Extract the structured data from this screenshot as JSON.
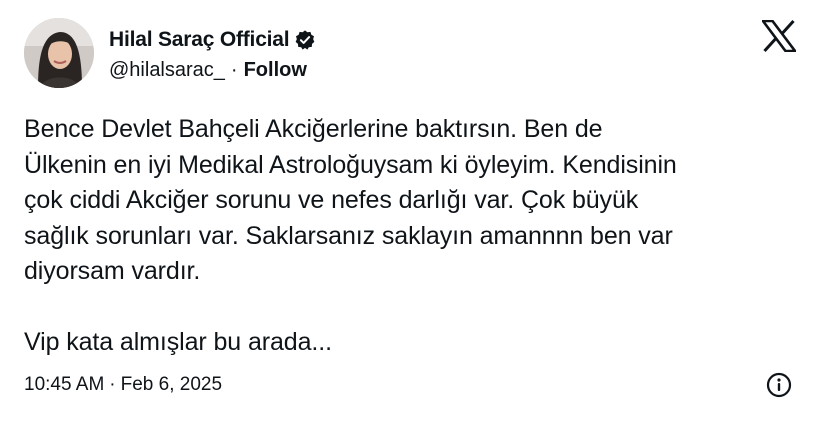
{
  "author": {
    "display_name": "Hilal Saraç Official",
    "handle": "@hilalsarac_",
    "separator": "·",
    "follow_label": "Follow",
    "verified_icon": "verified-badge-icon",
    "avatar_icon": "profile-photo"
  },
  "brand": {
    "logo_icon": "x-logo-icon"
  },
  "tweet": {
    "text": "Bence Devlet Bahçeli Akciğerlerine baktırsın. Ben de\nÜlkenin en iyi Medikal Astroloğuysam ki öyleyim. Kendisinin\nçok ciddi Akciğer sorunu ve nefes darlığı var. Çok büyük\nsağlık sorunları var. Saklarsanız saklayın amannnn ben var\ndiyorsam vardır.\n\nVip kata almışlar bu arada..."
  },
  "footer": {
    "time": "10:45 AM",
    "separator": "·",
    "date": "Feb 6, 2025",
    "info_icon": "info-icon"
  },
  "colors": {
    "text": "#0f1419",
    "background": "#ffffff"
  }
}
